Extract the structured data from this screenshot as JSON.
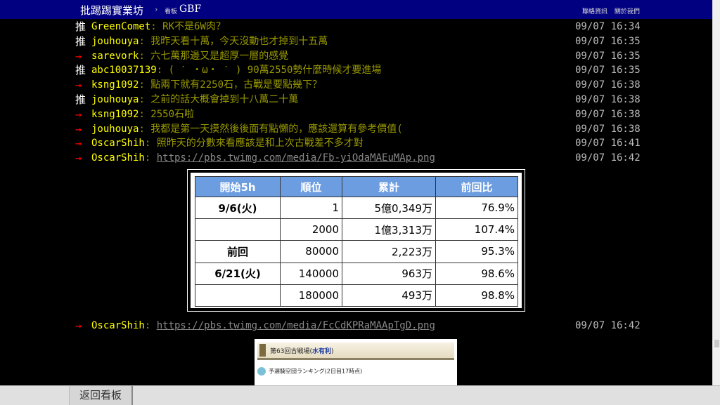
{
  "header": {
    "site_title": "批踢踢實業坊",
    "crumb_sep": "›",
    "board_label": "看板",
    "board_name": "GBF",
    "links": [
      "聯絡資訊",
      "關於我們"
    ]
  },
  "pushes": [
    {
      "tag": "推",
      "kind": "push",
      "user": "GreenComet",
      "content": ": RK不是6W肉？",
      "time": "09/07 16:34"
    },
    {
      "tag": "推",
      "kind": "push",
      "user": "jouhouya",
      "content": ": 我昨天看十萬，今天沒動也才掉到十五萬",
      "time": "09/07 16:35"
    },
    {
      "tag": "→",
      "kind": "arrow",
      "user": "sarevork",
      "content": ": 六七萬那邊又是超厚一層的感覺",
      "time": "09/07 16:35"
    },
    {
      "tag": "推",
      "kind": "push",
      "user": "abc10037139",
      "content": ": ( ˊ ・ω・ ˋ ) 90萬2550勢什麼時候才要進場",
      "time": "09/07 16:35"
    },
    {
      "tag": "→",
      "kind": "arrow",
      "user": "ksng1092",
      "content": ": 點兩下就有2250石，古戰是要點幾下？",
      "time": "09/07 16:38"
    },
    {
      "tag": "推",
      "kind": "push",
      "user": "jouhouya",
      "content": ": 之前的話大概會掉到十八萬二十萬",
      "time": "09/07 16:38"
    },
    {
      "tag": "→",
      "kind": "arrow",
      "user": "ksng1092",
      "content": ": 2550石啦",
      "time": "09/07 16:38"
    },
    {
      "tag": "→",
      "kind": "arrow",
      "user": "jouhouya",
      "content": ": 我都是第一天摸然後後面有點懶的，應該還算有參考價值(",
      "time": "09/07 16:38"
    },
    {
      "tag": "→",
      "kind": "arrow",
      "user": "OscarShih",
      "content": ": 照昨天的分數來看應該是和上次古戰差不多才對",
      "time": "09/07 16:41"
    },
    {
      "tag": "→",
      "kind": "arrow",
      "user": "OscarShih",
      "content": ": ",
      "link": "https://pbs.twimg.com/media/Fb-yiOdaMAEuMAp.png",
      "time": "09/07 16:42"
    }
  ],
  "push_after": {
    "tag": "→",
    "kind": "arrow",
    "user": "OscarShih",
    "content": ": ",
    "link": "https://pbs.twimg.com/media/FcCdKPRaMAApTgD.png",
    "time": "09/07 16:42"
  },
  "image_table": {
    "headers": [
      "開始5h",
      "順位",
      "累計",
      "前回比"
    ],
    "rows": [
      [
        "9/6(火)",
        "1",
        "5億0,349万",
        "76.9%"
      ],
      [
        "",
        "2000",
        "1億3,313万",
        "107.4%"
      ],
      [
        "前回",
        "80000",
        "2,223万",
        "95.3%"
      ],
      [
        "6/21(火)",
        "140000",
        "963万",
        "98.6%"
      ],
      [
        "",
        "180000",
        "493万",
        "98.8%"
      ]
    ]
  },
  "image2": {
    "title_prefix": "第63回古戦場(",
    "title_element": "水有利",
    "title_suffix": ")",
    "subtitle": "予選騎空団ランキング(2日目17時点)"
  },
  "footer": {
    "back_label": "返回看板"
  }
}
